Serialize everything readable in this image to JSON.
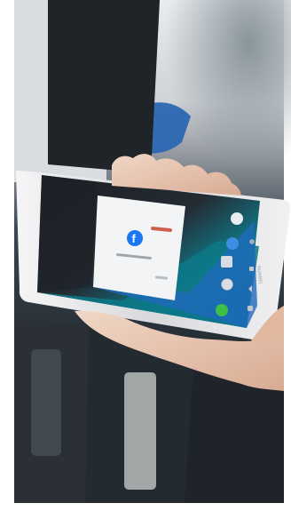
{
  "scene": {
    "description_label": "",
    "phone": {
      "brand_text": "HUAWEI",
      "dialog": {
        "app_icon": "facebook-icon",
        "title": "",
        "left_button": "",
        "right_button": ""
      },
      "home_icons": [
        "circle-icon",
        "chrome-like-icon",
        "grid-icon",
        "settings-icon",
        "dots-icon",
        "phone-icon",
        "message-icon"
      ],
      "nav_icons": [
        "back-icon",
        "home-icon",
        "square-icon"
      ]
    }
  },
  "colors": {
    "page_bg": "#ffffff",
    "scene_dark": "#1e2429",
    "phone_silver": "#d9d9db",
    "screen_dark": "#24282b",
    "screen_teal": "#0d7e8a",
    "screen_blue": "#1b67b8",
    "dialog_bg": "#f3f5f6",
    "facebook_blue": "#1877f2",
    "skin": "#e7c7b2",
    "green_icon": "#3dbf45"
  }
}
